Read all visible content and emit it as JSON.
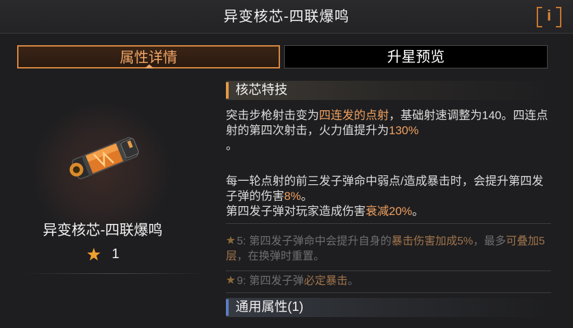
{
  "header": {
    "title": "异变核芯-四联爆鸣",
    "info_label": "i"
  },
  "tabs": {
    "detail": "属性详情",
    "star_preview": "升星预览"
  },
  "item": {
    "name": "异变核芯-四联爆鸣",
    "star_level": "1"
  },
  "core_skill": {
    "header": "核芯特技",
    "p1": {
      "a": "突击步枪射击变为",
      "b": "四连发的点射",
      "c": "，基础射速调整为140。四连点射的第四次射击，火力值提升为",
      "d": "130%",
      "e": "。"
    },
    "p2": {
      "a": "每一轮点射的前三发子弹命中弱点/造成暴击时，会提升第四发子弹的伤害",
      "b": "8%",
      "c": "。"
    },
    "p3": {
      "a": "第四发子弹对玩家造成伤害",
      "b": "衰减20%",
      "c": "。"
    }
  },
  "perks": [
    {
      "level": "5",
      "a": ": 第四发子弹命中会提升自身的",
      "b": "暴击伤害加成5%",
      "c": "，最多",
      "d": "可叠加5层",
      "e": "，在换弹时重置。"
    },
    {
      "level": "9",
      "a": ": 第四发子弹",
      "b": "必定暴击",
      "c": "。"
    }
  ],
  "general": {
    "header": "通用属性(1)"
  },
  "colors": {
    "accent": "#e59a4a",
    "highlight": "#f0a060",
    "muted": "#6e6e70",
    "blue_bar": "#5b7fc0"
  },
  "icons": [
    "info-icon",
    "star-icon",
    "core-item-icon"
  ]
}
